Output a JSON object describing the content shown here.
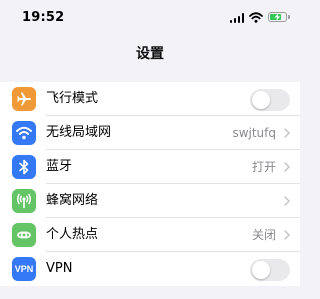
{
  "status_bar": {
    "time": "19:52",
    "battery_level": 0.7,
    "charging": true
  },
  "nav": {
    "title": "设置"
  },
  "rows": [
    {
      "label": "飞行模式",
      "icon": "airplane-icon",
      "icon_color": "#f09a37",
      "control": "toggle",
      "on": false
    },
    {
      "label": "无线局域网",
      "icon": "wifi-icon",
      "icon_color": "#3478f6",
      "value": "swjtufq",
      "control": "chevron"
    },
    {
      "label": "蓝牙",
      "icon": "bluetooth-icon",
      "icon_color": "#3478f6",
      "value": "打开",
      "control": "chevron"
    },
    {
      "label": "蜂窝网络",
      "icon": "cellular-icon",
      "icon_color": "#65c466",
      "control": "chevron"
    },
    {
      "label": "个人热点",
      "icon": "hotspot-icon",
      "icon_color": "#65c466",
      "value": "关闭",
      "control": "chevron"
    },
    {
      "label": "VPN",
      "icon": "vpn-icon",
      "icon_color": "#3478f6",
      "icon_text": "VPN",
      "control": "toggle",
      "on": false
    }
  ]
}
